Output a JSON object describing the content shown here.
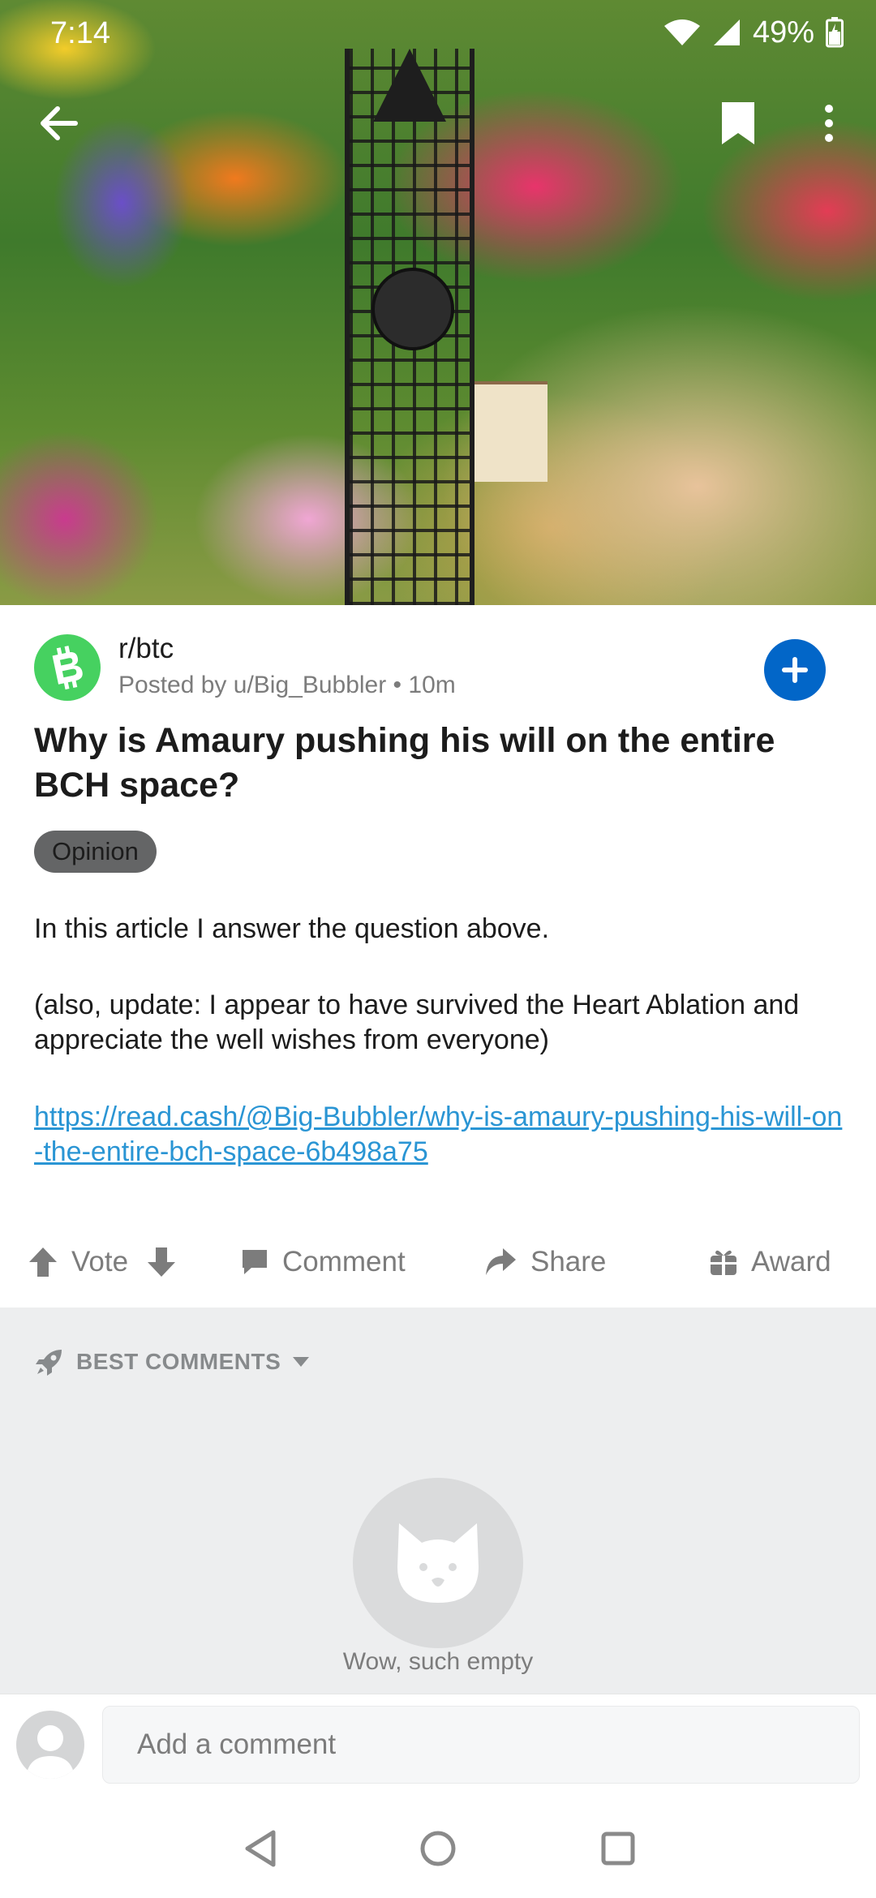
{
  "status_bar": {
    "time": "7:14",
    "battery": "49%"
  },
  "header": {
    "back_icon": "arrow-left-icon",
    "bookmark_icon": "bookmark-icon",
    "more_icon": "more-vertical-icon"
  },
  "post": {
    "subreddit": "r/btc",
    "meta": "Posted by u/Big_Bubbler • 10m",
    "title": "Why is Amaury pushing his will on the entire BCH space?",
    "flair": "Opinion",
    "body_paragraph_1": "In this article I answer the question above.",
    "body_paragraph_2": "(also, update: I appear to have survived the Heart Ablation and appreciate the well wishes from everyone)",
    "link": "https://read.cash/@Big-Bubbler/why-is-amaury-pushing-his-will-on-the-entire-bch-space-6b498a75",
    "subreddit_icon": "bitcoin-cash-icon",
    "join_icon": "plus-icon"
  },
  "actions": {
    "vote": "Vote",
    "comment": "Comment",
    "share": "Share",
    "award": "Award"
  },
  "comments": {
    "sort_label": "BEST COMMENTS",
    "empty_text": "Wow, such empty"
  },
  "composer": {
    "placeholder": "Add a comment"
  },
  "colors": {
    "accent_blue": "#0266c8",
    "link_blue": "#2a95d4",
    "subreddit_green": "#46d160",
    "flair_gray": "#646566",
    "muted_text": "#7c7c7c"
  }
}
